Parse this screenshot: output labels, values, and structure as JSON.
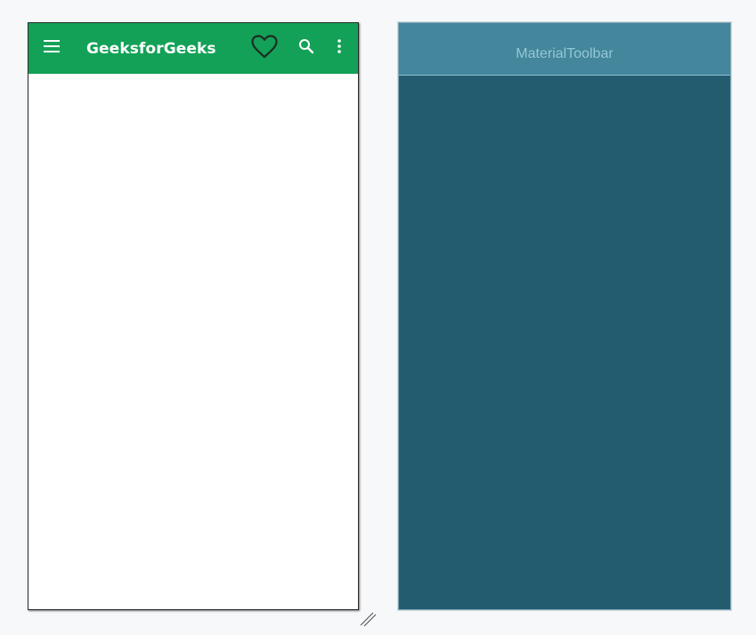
{
  "design": {
    "toolbar": {
      "title": "GeeksforGeeks",
      "background": "#13a157",
      "icons": {
        "navigation": "menu-icon",
        "favorite": "heart-outline-icon",
        "search": "search-icon",
        "overflow": "more-vertical-icon"
      }
    }
  },
  "blueprint": {
    "toolbar_label": "MaterialToolbar",
    "background": "#235c6f",
    "toolbar_background": "#44869b"
  }
}
